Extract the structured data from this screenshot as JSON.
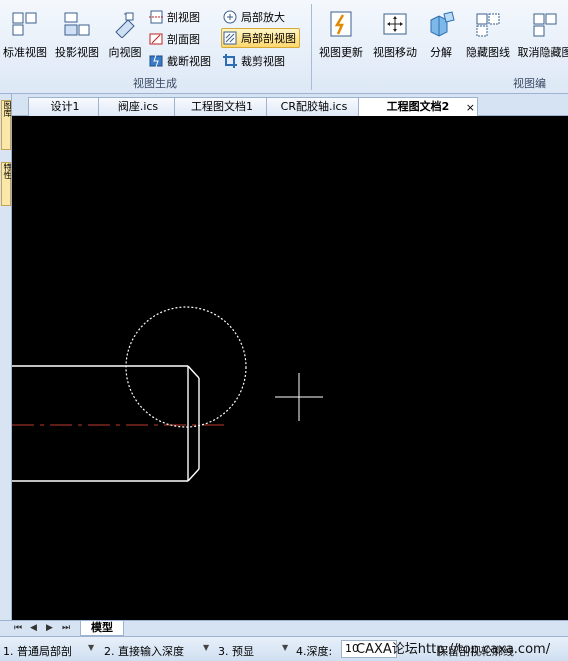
{
  "ribbon": {
    "view_generation": {
      "group_label": "视图生成",
      "standard_view": "标准视图",
      "projection_view": "投影视图",
      "direction_view": "向视图",
      "section_view": "剖视图",
      "cross_section": "剖面图",
      "break_view": "截断视图",
      "detail_view": "局部放大",
      "partial_section_view": "局部剖视图",
      "crop_view": "裁剪视图"
    },
    "view_edit": {
      "group_label": "视图编",
      "update_view": "视图更新",
      "move_view": "视图移动",
      "explode": "分解",
      "hide_lines": "隐藏图线",
      "unhide": "取消隐藏图"
    }
  },
  "left_strip": {
    "tab1": "图库",
    "tab2": "特性"
  },
  "doc_tabs": [
    {
      "label": "设计1"
    },
    {
      "label": "阀座.ics"
    },
    {
      "label": "工程图文档1"
    },
    {
      "label": "CR配胶轴.ics"
    },
    {
      "label": "工程图文档2",
      "active": true
    }
  ],
  "doc_tab_close": "×",
  "sheet_tabs": {
    "active": "模型",
    "nav": [
      "⏮",
      "◀",
      "▶",
      "⏭"
    ]
  },
  "status_bar": {
    "opt1": "1. 普通局部剖",
    "opt2": "2. 直接输入深度",
    "opt3": "3. 预显",
    "depth_label": "4.深度:",
    "depth_value": "10",
    "watermark": "CAXA论坛http://top.caxa.com/",
    "hidden_text": "保留剖视轮廓线"
  },
  "colors": {
    "canvas_bg": "#000000",
    "geometry": "#ffffff",
    "centerline": "#c0392b",
    "accent_active": "#ffd76e"
  }
}
